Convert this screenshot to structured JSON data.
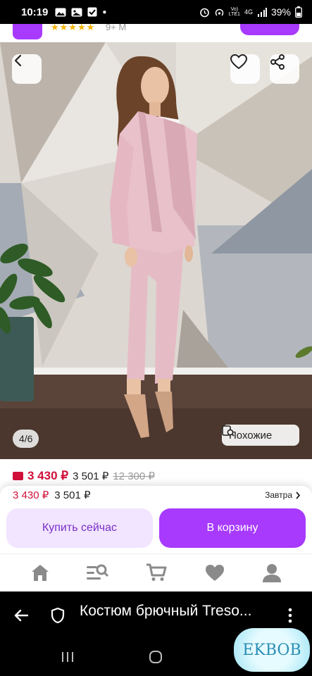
{
  "status_bar": {
    "time": "10:19",
    "net_top": "Vo)",
    "net_bottom": "LTE1",
    "net_type": "4G",
    "battery": "39%"
  },
  "store": {
    "rating_label": "9+ M"
  },
  "gallery": {
    "page_indicator": "4/6",
    "similar_label": "Похожие"
  },
  "price": {
    "current": "3 430 ₽",
    "alternative": "3 501 ₽",
    "old": "12 300 ₽"
  },
  "purchase_sheet": {
    "price": "3 430 ₽",
    "alt_price": "3 501 ₽",
    "delivery": "Завтра",
    "buy_now_label": "Купить сейчас",
    "add_to_cart_label": "В корзину"
  },
  "browser": {
    "page_title": "Костюм брючный Treso..."
  },
  "watermark": {
    "text": "EKBOB"
  },
  "colors": {
    "brand": "#a73afd",
    "price": "#d0103a",
    "suit": "#e8c1cb"
  }
}
